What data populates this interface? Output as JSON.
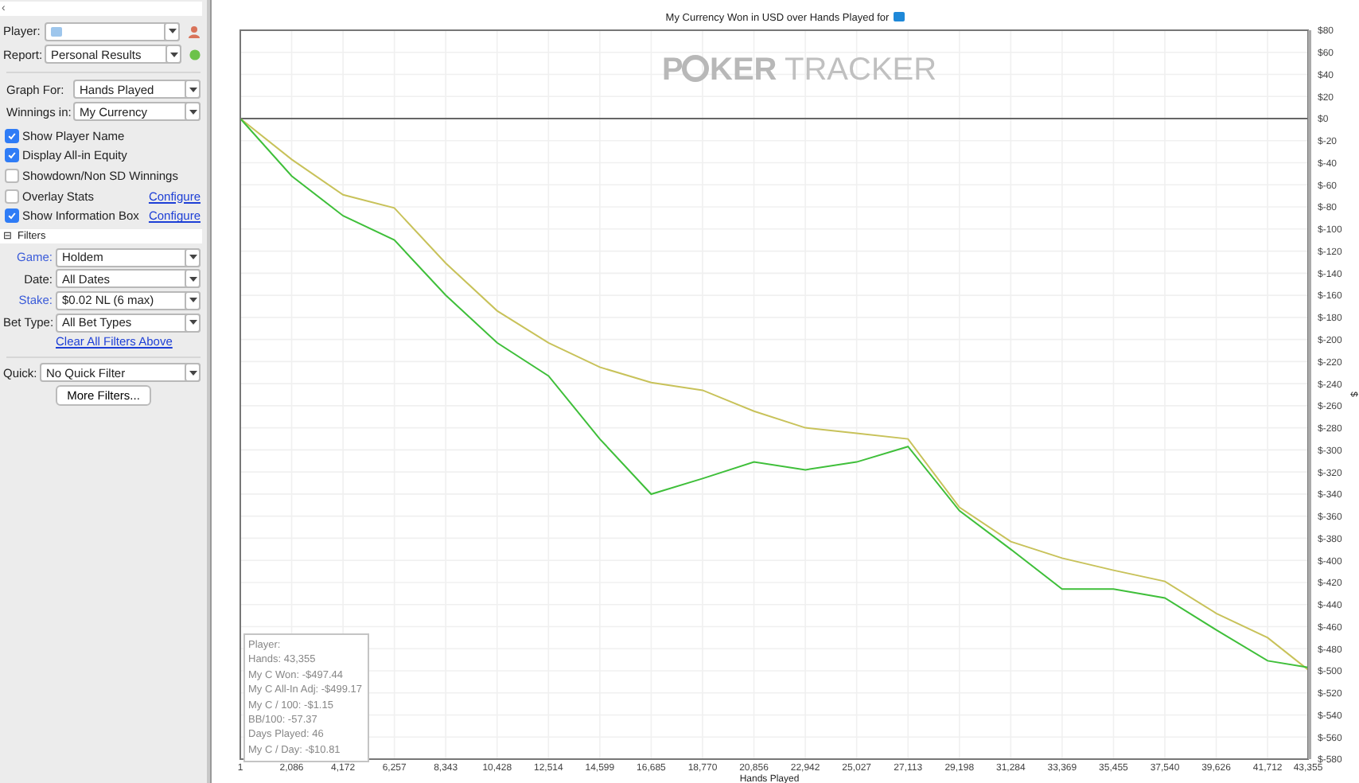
{
  "sidebar": {
    "collapse_glyph": "‹",
    "player": {
      "label": "Player:"
    },
    "report": {
      "label": "Report:",
      "value": "Personal Results"
    },
    "graph_options": [
      {
        "label": "Graph For:",
        "value": "Hands Played"
      },
      {
        "label": "Winnings in:",
        "value": "My Currency"
      }
    ],
    "checkboxes": [
      {
        "label": "Show Player Name",
        "checked": true
      },
      {
        "label": "Display All-in Equity",
        "checked": true
      },
      {
        "label": "Showdown/Non SD Winnings",
        "checked": false
      },
      {
        "label": "Overlay Stats",
        "checked": false,
        "link": "Configure"
      },
      {
        "label": "Show Information Box",
        "checked": true,
        "link": "Configure"
      }
    ],
    "filters_header": {
      "glyph": "⊟",
      "label": "Filters"
    },
    "filters": [
      {
        "label": "Game:",
        "value": "Holdem",
        "active": true
      },
      {
        "label": "Date:",
        "value": "All Dates",
        "active": false
      },
      {
        "label": "Stake:",
        "value": "$0.02 NL (6 max)",
        "active": true
      },
      {
        "label": "Bet Type:",
        "value": "All Bet Types",
        "active": false
      }
    ],
    "clear_link": "Clear All Filters Above",
    "quick": {
      "label": "Quick:",
      "value": "No Quick Filter"
    },
    "more_button": "More Filters..."
  },
  "chart": {
    "title": "My Currency Won in USD over Hands Played for",
    "watermark": [
      "P",
      "KER",
      "TRACKER"
    ],
    "info_box": [
      "Player:",
      "Hands: 43,355",
      "My C Won: -$497.44",
      "My C All-In Adj: -$499.17",
      "My C / 100: -$1.15",
      "BB/100: -57.37",
      "Days Played: 46",
      "My C / Day: -$10.81"
    ],
    "chart_data": {
      "type": "line",
      "xlabel": "Hands Played",
      "ylabel": "$",
      "x": [
        1,
        2086,
        4172,
        6257,
        8343,
        10428,
        12514,
        14599,
        16685,
        18770,
        20856,
        22942,
        25027,
        27113,
        29198,
        31284,
        33369,
        35455,
        37540,
        39626,
        41712,
        43355
      ],
      "series": [
        {
          "color": "#c8c25a",
          "values": [
            0,
            -37,
            -69,
            -81,
            -131,
            -174,
            -203,
            -225,
            -239,
            -246,
            -265,
            -280,
            -285,
            -290,
            -352,
            -383,
            -398,
            -409,
            -419,
            -448,
            -470,
            -499
          ]
        },
        {
          "color": "#3fbf3a",
          "values": [
            0,
            -52,
            -88,
            -110,
            -160,
            -203,
            -233,
            -290,
            -340,
            -326,
            -311,
            -318,
            -311,
            -297,
            -355,
            -390,
            -426,
            -426,
            -434,
            -463,
            -491,
            -497
          ]
        }
      ],
      "grid": true,
      "xlim": [
        1,
        43355
      ],
      "ylim": [
        -580,
        80
      ],
      "xticks": [
        {
          "value": 1,
          "label": "1"
        },
        {
          "value": 2086,
          "label": "2,086"
        },
        {
          "value": 4172,
          "label": "4,172"
        },
        {
          "value": 6257,
          "label": "6,257"
        },
        {
          "value": 8343,
          "label": "8,343"
        },
        {
          "value": 10428,
          "label": "10,428"
        },
        {
          "value": 12514,
          "label": "12,514"
        },
        {
          "value": 14599,
          "label": "14,599"
        },
        {
          "value": 16685,
          "label": "16,685"
        },
        {
          "value": 18770,
          "label": "18,770"
        },
        {
          "value": 20856,
          "label": "20,856"
        },
        {
          "value": 22942,
          "label": "22,942"
        },
        {
          "value": 25027,
          "label": "25,027"
        },
        {
          "value": 27113,
          "label": "27,113"
        },
        {
          "value": 29198,
          "label": "29,198"
        },
        {
          "value": 31284,
          "label": "31,284"
        },
        {
          "value": 33369,
          "label": "33,369"
        },
        {
          "value": 35455,
          "label": "35,455"
        },
        {
          "value": 37540,
          "label": "37,540"
        },
        {
          "value": 39626,
          "label": "39,626"
        },
        {
          "value": 41712,
          "label": "41,712"
        },
        {
          "value": 43355,
          "label": "43,355"
        }
      ],
      "yticks": [
        {
          "value": 80,
          "label": "$80"
        },
        {
          "value": 60,
          "label": "$60"
        },
        {
          "value": 40,
          "label": "$40"
        },
        {
          "value": 20,
          "label": "$20"
        },
        {
          "value": 0,
          "label": "$0"
        },
        {
          "value": -20,
          "label": "$-20"
        },
        {
          "value": -40,
          "label": "$-40"
        },
        {
          "value": -60,
          "label": "$-60"
        },
        {
          "value": -80,
          "label": "$-80"
        },
        {
          "value": -100,
          "label": "$-100"
        },
        {
          "value": -120,
          "label": "$-120"
        },
        {
          "value": -140,
          "label": "$-140"
        },
        {
          "value": -160,
          "label": "$-160"
        },
        {
          "value": -180,
          "label": "$-180"
        },
        {
          "value": -200,
          "label": "$-200"
        },
        {
          "value": -220,
          "label": "$-220"
        },
        {
          "value": -240,
          "label": "$-240"
        },
        {
          "value": -260,
          "label": "$-260"
        },
        {
          "value": -280,
          "label": "$-280"
        },
        {
          "value": -300,
          "label": "$-300"
        },
        {
          "value": -320,
          "label": "$-320"
        },
        {
          "value": -340,
          "label": "$-340"
        },
        {
          "value": -360,
          "label": "$-360"
        },
        {
          "value": -380,
          "label": "$-380"
        },
        {
          "value": -400,
          "label": "$-400"
        },
        {
          "value": -420,
          "label": "$-420"
        },
        {
          "value": -440,
          "label": "$-440"
        },
        {
          "value": -460,
          "label": "$-460"
        },
        {
          "value": -480,
          "label": "$-480"
        },
        {
          "value": -500,
          "label": "$-500"
        },
        {
          "value": -520,
          "label": "$-520"
        },
        {
          "value": -540,
          "label": "$-540"
        },
        {
          "value": -560,
          "label": "$-560"
        },
        {
          "value": -580,
          "label": "$-580"
        }
      ]
    }
  }
}
